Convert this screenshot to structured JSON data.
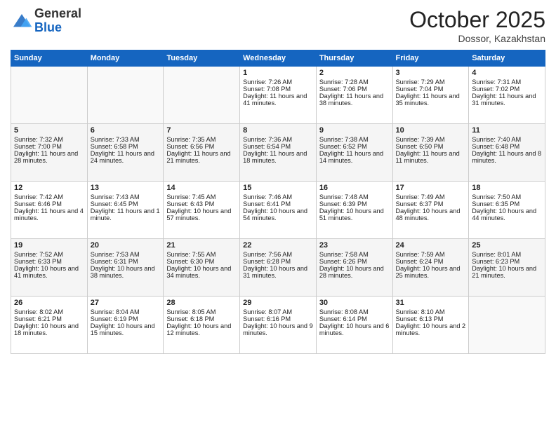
{
  "header": {
    "logo_general": "General",
    "logo_blue": "Blue",
    "month": "October 2025",
    "location": "Dossor, Kazakhstan"
  },
  "days_of_week": [
    "Sunday",
    "Monday",
    "Tuesday",
    "Wednesday",
    "Thursday",
    "Friday",
    "Saturday"
  ],
  "weeks": [
    [
      {
        "day": "",
        "sunrise": "",
        "sunset": "",
        "daylight": "",
        "empty": true
      },
      {
        "day": "",
        "sunrise": "",
        "sunset": "",
        "daylight": "",
        "empty": true
      },
      {
        "day": "",
        "sunrise": "",
        "sunset": "",
        "daylight": "",
        "empty": true
      },
      {
        "day": "1",
        "sunrise": "Sunrise: 7:26 AM",
        "sunset": "Sunset: 7:08 PM",
        "daylight": "Daylight: 11 hours and 41 minutes."
      },
      {
        "day": "2",
        "sunrise": "Sunrise: 7:28 AM",
        "sunset": "Sunset: 7:06 PM",
        "daylight": "Daylight: 11 hours and 38 minutes."
      },
      {
        "day": "3",
        "sunrise": "Sunrise: 7:29 AM",
        "sunset": "Sunset: 7:04 PM",
        "daylight": "Daylight: 11 hours and 35 minutes."
      },
      {
        "day": "4",
        "sunrise": "Sunrise: 7:31 AM",
        "sunset": "Sunset: 7:02 PM",
        "daylight": "Daylight: 11 hours and 31 minutes."
      }
    ],
    [
      {
        "day": "5",
        "sunrise": "Sunrise: 7:32 AM",
        "sunset": "Sunset: 7:00 PM",
        "daylight": "Daylight: 11 hours and 28 minutes."
      },
      {
        "day": "6",
        "sunrise": "Sunrise: 7:33 AM",
        "sunset": "Sunset: 6:58 PM",
        "daylight": "Daylight: 11 hours and 24 minutes."
      },
      {
        "day": "7",
        "sunrise": "Sunrise: 7:35 AM",
        "sunset": "Sunset: 6:56 PM",
        "daylight": "Daylight: 11 hours and 21 minutes."
      },
      {
        "day": "8",
        "sunrise": "Sunrise: 7:36 AM",
        "sunset": "Sunset: 6:54 PM",
        "daylight": "Daylight: 11 hours and 18 minutes."
      },
      {
        "day": "9",
        "sunrise": "Sunrise: 7:38 AM",
        "sunset": "Sunset: 6:52 PM",
        "daylight": "Daylight: 11 hours and 14 minutes."
      },
      {
        "day": "10",
        "sunrise": "Sunrise: 7:39 AM",
        "sunset": "Sunset: 6:50 PM",
        "daylight": "Daylight: 11 hours and 11 minutes."
      },
      {
        "day": "11",
        "sunrise": "Sunrise: 7:40 AM",
        "sunset": "Sunset: 6:48 PM",
        "daylight": "Daylight: 11 hours and 8 minutes."
      }
    ],
    [
      {
        "day": "12",
        "sunrise": "Sunrise: 7:42 AM",
        "sunset": "Sunset: 6:46 PM",
        "daylight": "Daylight: 11 hours and 4 minutes."
      },
      {
        "day": "13",
        "sunrise": "Sunrise: 7:43 AM",
        "sunset": "Sunset: 6:45 PM",
        "daylight": "Daylight: 11 hours and 1 minute."
      },
      {
        "day": "14",
        "sunrise": "Sunrise: 7:45 AM",
        "sunset": "Sunset: 6:43 PM",
        "daylight": "Daylight: 10 hours and 57 minutes."
      },
      {
        "day": "15",
        "sunrise": "Sunrise: 7:46 AM",
        "sunset": "Sunset: 6:41 PM",
        "daylight": "Daylight: 10 hours and 54 minutes."
      },
      {
        "day": "16",
        "sunrise": "Sunrise: 7:48 AM",
        "sunset": "Sunset: 6:39 PM",
        "daylight": "Daylight: 10 hours and 51 minutes."
      },
      {
        "day": "17",
        "sunrise": "Sunrise: 7:49 AM",
        "sunset": "Sunset: 6:37 PM",
        "daylight": "Daylight: 10 hours and 48 minutes."
      },
      {
        "day": "18",
        "sunrise": "Sunrise: 7:50 AM",
        "sunset": "Sunset: 6:35 PM",
        "daylight": "Daylight: 10 hours and 44 minutes."
      }
    ],
    [
      {
        "day": "19",
        "sunrise": "Sunrise: 7:52 AM",
        "sunset": "Sunset: 6:33 PM",
        "daylight": "Daylight: 10 hours and 41 minutes."
      },
      {
        "day": "20",
        "sunrise": "Sunrise: 7:53 AM",
        "sunset": "Sunset: 6:31 PM",
        "daylight": "Daylight: 10 hours and 38 minutes."
      },
      {
        "day": "21",
        "sunrise": "Sunrise: 7:55 AM",
        "sunset": "Sunset: 6:30 PM",
        "daylight": "Daylight: 10 hours and 34 minutes."
      },
      {
        "day": "22",
        "sunrise": "Sunrise: 7:56 AM",
        "sunset": "Sunset: 6:28 PM",
        "daylight": "Daylight: 10 hours and 31 minutes."
      },
      {
        "day": "23",
        "sunrise": "Sunrise: 7:58 AM",
        "sunset": "Sunset: 6:26 PM",
        "daylight": "Daylight: 10 hours and 28 minutes."
      },
      {
        "day": "24",
        "sunrise": "Sunrise: 7:59 AM",
        "sunset": "Sunset: 6:24 PM",
        "daylight": "Daylight: 10 hours and 25 minutes."
      },
      {
        "day": "25",
        "sunrise": "Sunrise: 8:01 AM",
        "sunset": "Sunset: 6:23 PM",
        "daylight": "Daylight: 10 hours and 21 minutes."
      }
    ],
    [
      {
        "day": "26",
        "sunrise": "Sunrise: 8:02 AM",
        "sunset": "Sunset: 6:21 PM",
        "daylight": "Daylight: 10 hours and 18 minutes."
      },
      {
        "day": "27",
        "sunrise": "Sunrise: 8:04 AM",
        "sunset": "Sunset: 6:19 PM",
        "daylight": "Daylight: 10 hours and 15 minutes."
      },
      {
        "day": "28",
        "sunrise": "Sunrise: 8:05 AM",
        "sunset": "Sunset: 6:18 PM",
        "daylight": "Daylight: 10 hours and 12 minutes."
      },
      {
        "day": "29",
        "sunrise": "Sunrise: 8:07 AM",
        "sunset": "Sunset: 6:16 PM",
        "daylight": "Daylight: 10 hours and 9 minutes."
      },
      {
        "day": "30",
        "sunrise": "Sunrise: 8:08 AM",
        "sunset": "Sunset: 6:14 PM",
        "daylight": "Daylight: 10 hours and 6 minutes."
      },
      {
        "day": "31",
        "sunrise": "Sunrise: 8:10 AM",
        "sunset": "Sunset: 6:13 PM",
        "daylight": "Daylight: 10 hours and 2 minutes."
      },
      {
        "day": "",
        "sunrise": "",
        "sunset": "",
        "daylight": "",
        "empty": true
      }
    ]
  ]
}
